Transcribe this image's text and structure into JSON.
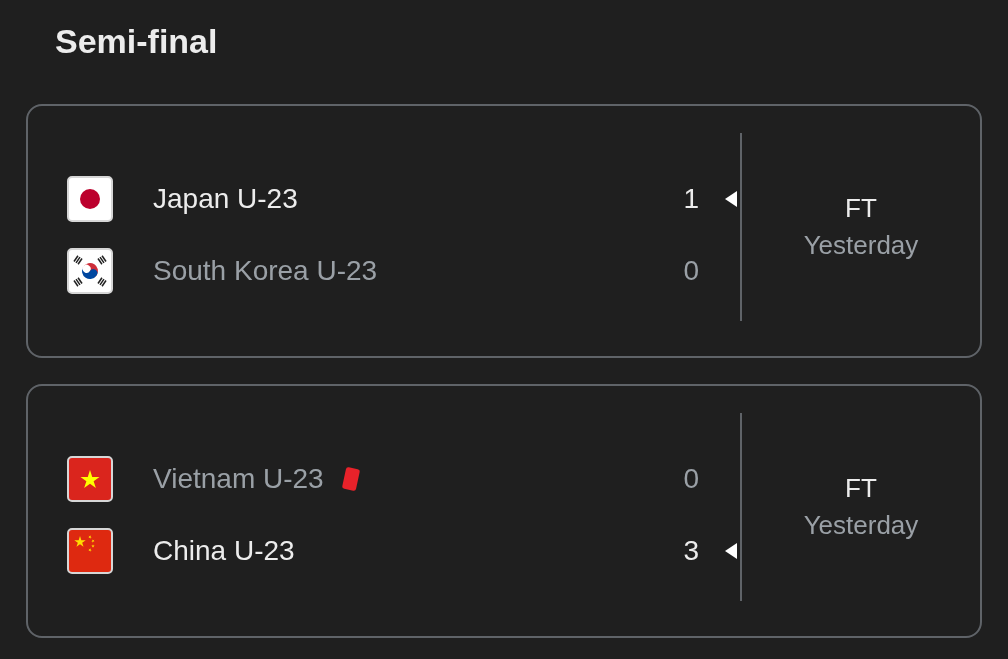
{
  "title": "Semi-final",
  "matches": [
    {
      "teams": [
        {
          "name": "Japan U-23",
          "kind": "japan",
          "score": "1",
          "winner": true,
          "red_card": false
        },
        {
          "name": "South Korea U-23",
          "kind": "korea",
          "score": "0",
          "winner": false,
          "red_card": false
        }
      ],
      "status": "FT",
      "date": "Yesterday"
    },
    {
      "teams": [
        {
          "name": "Vietnam U-23",
          "kind": "vietnam",
          "score": "0",
          "winner": false,
          "red_card": true
        },
        {
          "name": "China U-23",
          "kind": "china",
          "score": "3",
          "winner": true,
          "red_card": false
        }
      ],
      "status": "FT",
      "date": "Yesterday"
    }
  ]
}
